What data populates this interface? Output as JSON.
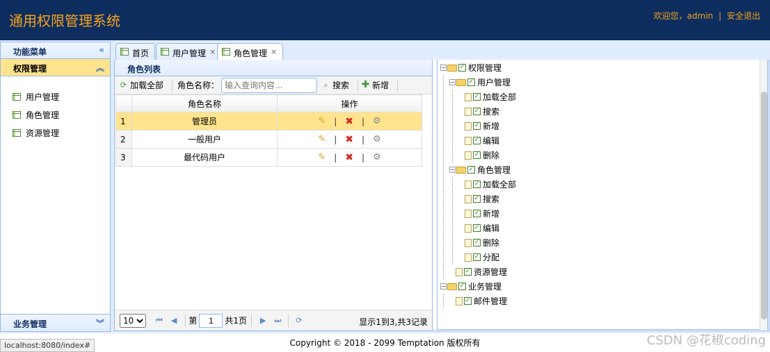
{
  "header": {
    "title": "通用权限管理系统",
    "welcome": "欢迎您，admin",
    "separator": "|",
    "logout": "安全退出"
  },
  "sidebar": {
    "title": "功能菜单",
    "collapse_icon": "double-chevron-left-icon",
    "group_active": "权限管理",
    "items": [
      {
        "label": "用户管理"
      },
      {
        "label": "角色管理"
      },
      {
        "label": "资源管理"
      }
    ],
    "group_bottom": "业务管理"
  },
  "tabs": [
    {
      "label": "首页",
      "closable": false
    },
    {
      "label": "用户管理",
      "closable": true
    },
    {
      "label": "角色管理",
      "closable": true,
      "selected": true
    }
  ],
  "grid": {
    "title": "角色列表",
    "toolbar": {
      "load_all": "加载全部",
      "name_label": "角色名称：",
      "search_placeholder": "输入查询内容...",
      "search": "搜索",
      "add": "新增"
    },
    "columns": [
      "角色名称",
      "操作"
    ],
    "rows": [
      {
        "num": "1",
        "name": "管理员"
      },
      {
        "num": "2",
        "name": "一般用户"
      },
      {
        "num": "3",
        "name": "最代码用户"
      }
    ],
    "pager": {
      "page_size": "10",
      "page_prefix": "第",
      "page": "1",
      "page_suffix": "共1页",
      "info": "显示1到3,共3记录"
    }
  },
  "tree": [
    {
      "label": "权限管理",
      "level": 0,
      "type": "folder"
    },
    {
      "label": "用户管理",
      "level": 1,
      "type": "folder"
    },
    {
      "label": "加载全部",
      "level": 2,
      "type": "file"
    },
    {
      "label": "搜索",
      "level": 2,
      "type": "file"
    },
    {
      "label": "新增",
      "level": 2,
      "type": "file"
    },
    {
      "label": "编辑",
      "level": 2,
      "type": "file"
    },
    {
      "label": "删除",
      "level": 2,
      "type": "file"
    },
    {
      "label": "角色管理",
      "level": 1,
      "type": "folder"
    },
    {
      "label": "加载全部",
      "level": 2,
      "type": "file"
    },
    {
      "label": "搜索",
      "level": 2,
      "type": "file"
    },
    {
      "label": "新增",
      "level": 2,
      "type": "file"
    },
    {
      "label": "编辑",
      "level": 2,
      "type": "file"
    },
    {
      "label": "删除",
      "level": 2,
      "type": "file"
    },
    {
      "label": "分配",
      "level": 2,
      "type": "file"
    },
    {
      "label": "资源管理",
      "level": 1,
      "type": "file"
    },
    {
      "label": "业务管理",
      "level": 0,
      "type": "folder"
    },
    {
      "label": "邮件管理",
      "level": 1,
      "type": "file"
    }
  ],
  "footer": "Copyright © 2018 - 2099 Temptation 版权所有",
  "status_url": "localhost:8080/index#",
  "watermark": "CSDN @花椒coding"
}
